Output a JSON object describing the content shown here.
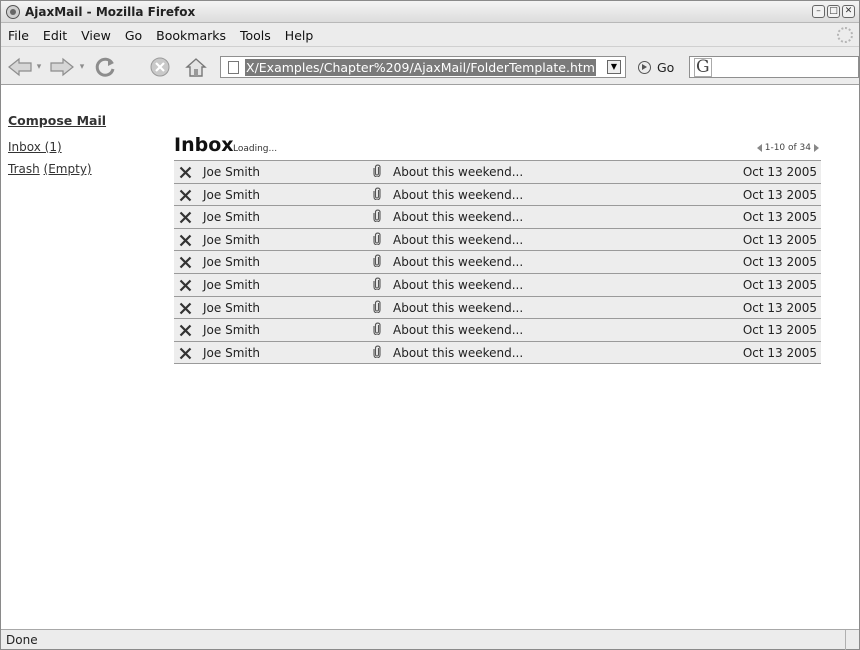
{
  "window": {
    "title": "AjaxMail - Mozilla Firefox",
    "controls": [
      "minimize",
      "maximize",
      "close"
    ]
  },
  "menubar": {
    "items": [
      {
        "label": "File"
      },
      {
        "label": "Edit"
      },
      {
        "label": "View"
      },
      {
        "label": "Go"
      },
      {
        "label": "Bookmarks"
      },
      {
        "label": "Tools"
      },
      {
        "label": "Help"
      }
    ]
  },
  "toolbar": {
    "url": "X/Examples/Chapter%209/AjaxMail/FolderTemplate.htm",
    "go_label": "Go",
    "search_engine_glyph": "G"
  },
  "sidebar": {
    "compose_label": "Compose Mail",
    "inbox_label": "Inbox (1)",
    "trash_label": "Trash",
    "trash_action": "(Empty)"
  },
  "main": {
    "folder_title": "Inbox",
    "loading_text": "Loading...",
    "pager_text": "1-10 of 34",
    "messages": [
      {
        "from": "Joe Smith",
        "subject": "About this weekend...",
        "date": "Oct 13 2005"
      },
      {
        "from": "Joe Smith",
        "subject": "About this weekend...",
        "date": "Oct 13 2005"
      },
      {
        "from": "Joe Smith",
        "subject": "About this weekend...",
        "date": "Oct 13 2005"
      },
      {
        "from": "Joe Smith",
        "subject": "About this weekend...",
        "date": "Oct 13 2005"
      },
      {
        "from": "Joe Smith",
        "subject": "About this weekend...",
        "date": "Oct 13 2005"
      },
      {
        "from": "Joe Smith",
        "subject": "About this weekend...",
        "date": "Oct 13 2005"
      },
      {
        "from": "Joe Smith",
        "subject": "About this weekend...",
        "date": "Oct 13 2005"
      },
      {
        "from": "Joe Smith",
        "subject": "About this weekend...",
        "date": "Oct 13 2005"
      },
      {
        "from": "Joe Smith",
        "subject": "About this weekend...",
        "date": "Oct 13 2005"
      }
    ]
  },
  "statusbar": {
    "text": "Done"
  },
  "colors": {
    "row_background": "#ededed",
    "row_border": "#9a9a9a",
    "chrome": "#ececec",
    "url_selection": "#7a7a7a"
  }
}
